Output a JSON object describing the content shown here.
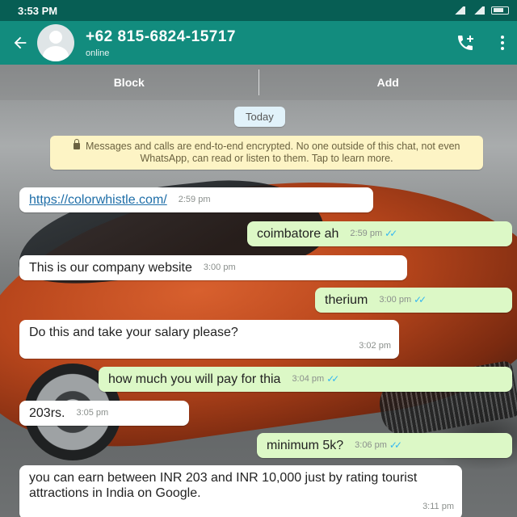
{
  "status_bar": {
    "time": "3:53 PM"
  },
  "header": {
    "contact_name": "+62 815-6824-15717",
    "contact_status": "online"
  },
  "actions": {
    "block": "Block",
    "add": "Add"
  },
  "chat": {
    "date_label": "Today",
    "encryption_note": "Messages and calls are end-to-end encrypted. No one outside of this chat, not even WhatsApp, can read or listen to them. Tap to learn more.",
    "messages": [
      {
        "direction": "in",
        "text": "https://colorwhistle.com/",
        "time": "2:59 pm"
      },
      {
        "direction": "out",
        "text": "coimbatore ah",
        "time": "2:59 pm"
      },
      {
        "direction": "in",
        "text": "This is our company website",
        "time": "3:00 pm"
      },
      {
        "direction": "out",
        "text": "therium",
        "time": "3:00 pm"
      },
      {
        "direction": "in",
        "text": "Do this and take your salary please?",
        "time": "3:02 pm"
      },
      {
        "direction": "out",
        "text": "how much you will pay for thia",
        "time": "3:04 pm"
      },
      {
        "direction": "in",
        "text": "203rs.",
        "time": "3:05 pm"
      },
      {
        "direction": "out",
        "text": "minimum 5k?",
        "time": "3:06 pm"
      },
      {
        "direction": "in",
        "text": "you can earn between INR 203 and INR 10,000 just by rating tourist attractions in India on Google.",
        "time": "3:11 pm"
      }
    ]
  },
  "colors": {
    "status_bar": "#075e54",
    "header": "#128c7e",
    "outgoing_bubble": "#dcf8c6",
    "incoming_bubble": "#ffffff",
    "read_ticks": "#34b7f1"
  },
  "icons": [
    "back-arrow-icon",
    "avatar",
    "add-call-icon",
    "more-vert-icon",
    "lock-icon",
    "double-tick-icon"
  ]
}
